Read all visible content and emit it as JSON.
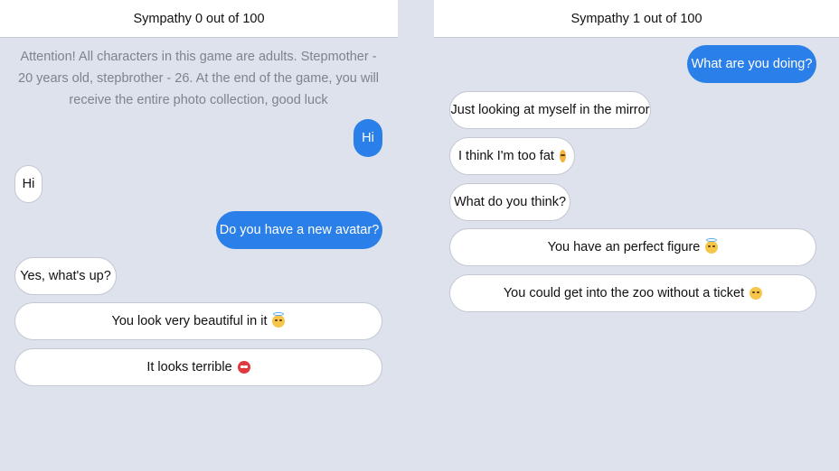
{
  "left_panel": {
    "header": "Sympathy 0 out of 100",
    "notice": "Attention! All characters in this game are adults. Stepmother - 20 years old, stepbrother - 26. At the end of the game, you will receive the entire photo collection, good luck",
    "messages": [
      {
        "from": "out",
        "text": "Hi"
      },
      {
        "from": "in",
        "text": "Hi"
      },
      {
        "from": "out",
        "text": "Do you have a new avatar?"
      },
      {
        "from": "in",
        "text": "Yes, what's up?"
      }
    ],
    "choices": [
      {
        "text": "You look very beautiful in it",
        "icon": "smiling-face-with-halo-icon"
      },
      {
        "text": "It looks terrible",
        "icon": "angry-face-icon"
      }
    ]
  },
  "right_panel": {
    "header": "Sympathy 1 out of 100",
    "messages": [
      {
        "from": "out",
        "text": "What are you doing?"
      },
      {
        "from": "in",
        "text": "Just looking at myself in the mirror"
      },
      {
        "from": "in",
        "text": "I think I'm too fat",
        "icon": "disappointed-face-icon"
      },
      {
        "from": "in",
        "text": "What do you think?"
      }
    ],
    "choices": [
      {
        "text": "You have an perfect figure",
        "icon": "smiling-face-with-halo-icon"
      },
      {
        "text": "You could get into the zoo without a ticket",
        "icon": "laughing-face-icon"
      }
    ]
  },
  "colors": {
    "background": "#dde2ed",
    "outgoing_bubble": "#2a7fe8",
    "incoming_bubble": "#ffffff",
    "notice_text": "#7e838c"
  }
}
